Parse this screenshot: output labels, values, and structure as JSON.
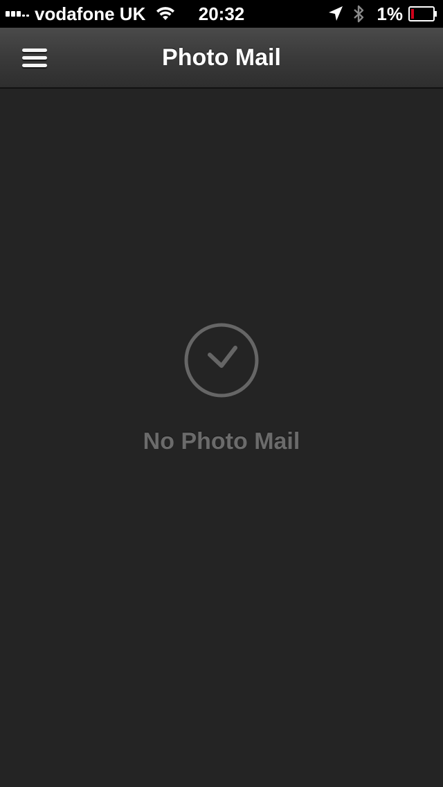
{
  "status_bar": {
    "carrier": "vodafone UK",
    "time": "20:32",
    "battery_percent": "1%",
    "icons": [
      "signal-icon",
      "wifi-icon",
      "location-icon",
      "bluetooth-icon",
      "battery-icon"
    ]
  },
  "nav_bar": {
    "title": "Photo Mail",
    "menu_icon": "hamburger-menu-icon"
  },
  "empty_state": {
    "icon": "clock-icon",
    "label": "No Photo Mail"
  },
  "colors": {
    "background": "#242424",
    "nav_bar": "#3a3a3a",
    "empty_text": "#6b6b6b",
    "battery_low": "#d0021b"
  }
}
